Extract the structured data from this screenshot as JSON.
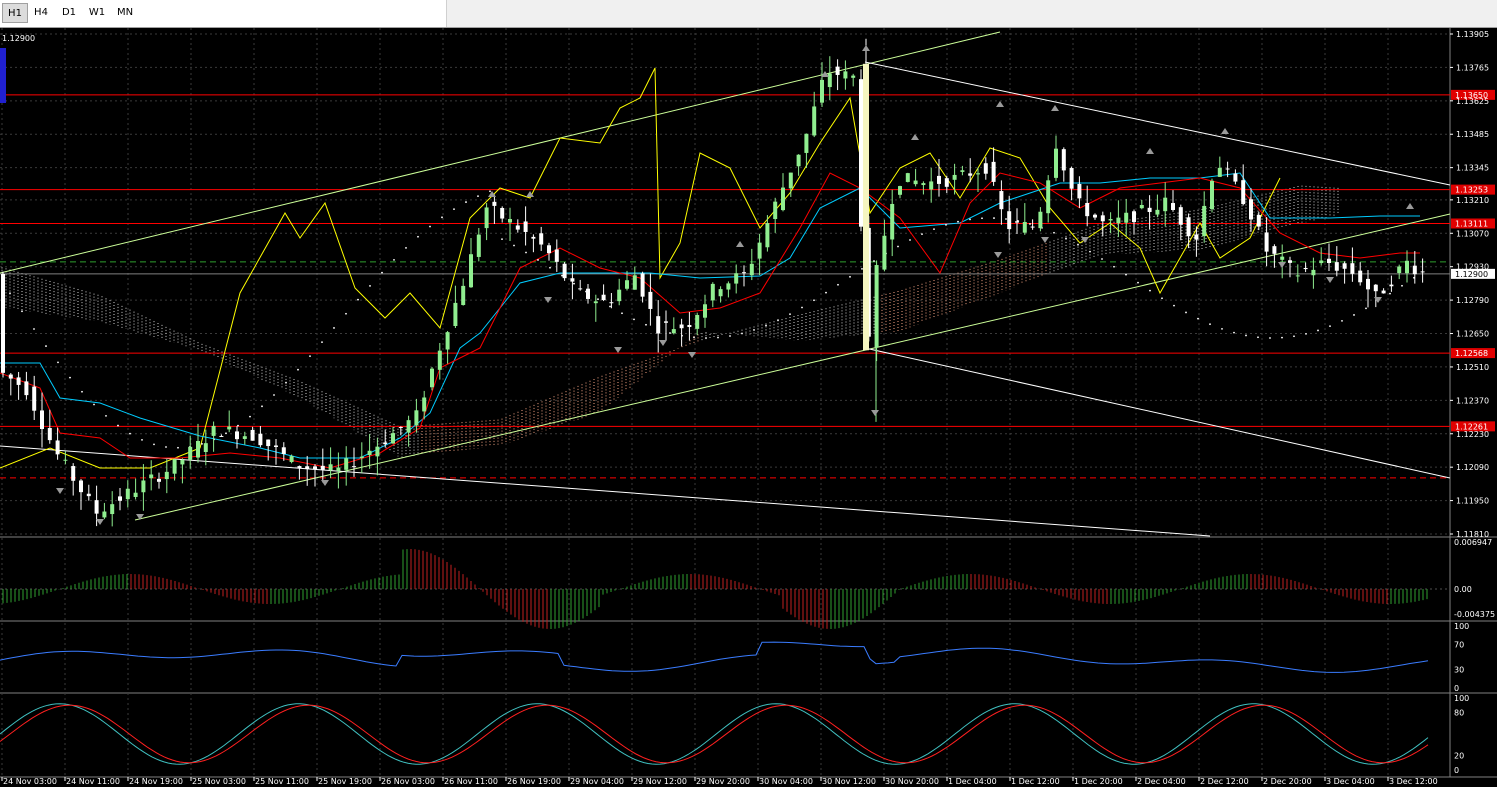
{
  "toolbar": {
    "timeframes": [
      "H1",
      "H4",
      "D1",
      "W1",
      "MN"
    ],
    "active": "H1"
  },
  "main_chart": {
    "corner_price": "1.12900",
    "price_axis": [
      "1.13905",
      "1.13765",
      "1.13625",
      "1.13485",
      "1.13345",
      "1.13210",
      "1.13070",
      "1.12930",
      "1.12790",
      "1.12650",
      "1.12510",
      "1.12370",
      "1.12230",
      "1.12090",
      "1.11950",
      "1.11810"
    ],
    "current_price": "1.12900",
    "levels": [
      {
        "label": "1.13650",
        "price": 1.1365
      },
      {
        "label": "1.13253",
        "price": 1.13253
      },
      {
        "label": "1.13111",
        "price": 1.13111
      },
      {
        "label": "1.12568",
        "price": 1.12568
      },
      {
        "label": "1.12261",
        "price": 1.12261
      }
    ],
    "dashed_level": 1.12045
  },
  "histogram_panel": {
    "labels": [
      "0.006947",
      "0.00",
      "-0.004375"
    ]
  },
  "rsi_panel": {
    "labels": [
      "100",
      "70",
      "30",
      "0"
    ]
  },
  "stoch_panel": {
    "labels": [
      "100",
      "80",
      "20",
      "0"
    ]
  },
  "time_axis": [
    "24 Nov 03:00",
    "24 Nov 11:00",
    "24 Nov 19:00",
    "25 Nov 03:00",
    "25 Nov 11:00",
    "25 Nov 19:00",
    "26 Nov 03:00",
    "26 Nov 11:00",
    "26 Nov 19:00",
    "29 Nov 04:00",
    "29 Nov 12:00",
    "29 Nov 20:00",
    "30 Nov 04:00",
    "30 Nov 12:00",
    "30 Nov 20:00",
    "1 Dec 04:00",
    "1 Dec 12:00",
    "1 Dec 20:00",
    "2 Dec 04:00",
    "2 Dec 12:00",
    "2 Dec 20:00",
    "3 Dec 04:00",
    "3 Dec 12:00"
  ],
  "colors": {
    "background": "#000000",
    "grid": "#3a3a3a",
    "bull": "#90ee90",
    "bear": "#ffffff",
    "level": "#ff0000",
    "trend": "#ccff99",
    "channel": "#ffffff",
    "yellow": "#ffff00",
    "kijun": "#00ccff",
    "tenkan": "#ff0000",
    "rsi": "#3a7cff",
    "stoch_main": "#40c0c0",
    "stoch_signal": "#ff2020"
  }
}
